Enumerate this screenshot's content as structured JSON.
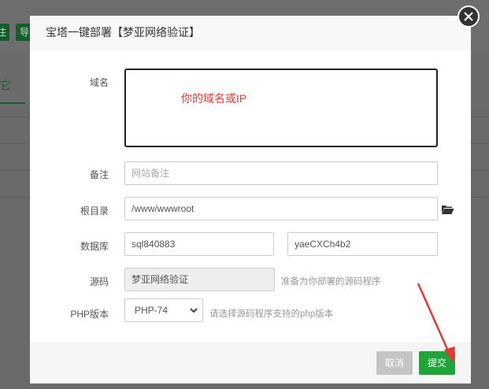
{
  "background": {
    "buttons": [
      "注",
      "导"
    ],
    "tab_label": "其它"
  },
  "modal": {
    "title": "宝塔一键部署【梦亚网络验证】",
    "close_icon": "close-icon",
    "fields": {
      "domain": {
        "label": "域名",
        "hint": "你的域名或IP"
      },
      "remark": {
        "label": "备注",
        "placeholder": "网站备注"
      },
      "root_dir": {
        "label": "根目录",
        "value": "/www/wwwroot"
      },
      "database": {
        "label": "数据库",
        "name": "sql840883",
        "password": "yaeCXCh4b2"
      },
      "source": {
        "label": "源码",
        "value": "梦亚网络验证",
        "hint": "准备为你部署的源码程序"
      },
      "php": {
        "label": "PHP版本",
        "selected": "PHP-74",
        "hint": "请选择源码程序支持的php版本"
      }
    },
    "footer": {
      "cancel_label": "取消",
      "submit_label": "提交"
    }
  },
  "colors": {
    "accent": "#20a53a",
    "hint_red": "#e53935",
    "annotation_arrow": "#e53935"
  }
}
